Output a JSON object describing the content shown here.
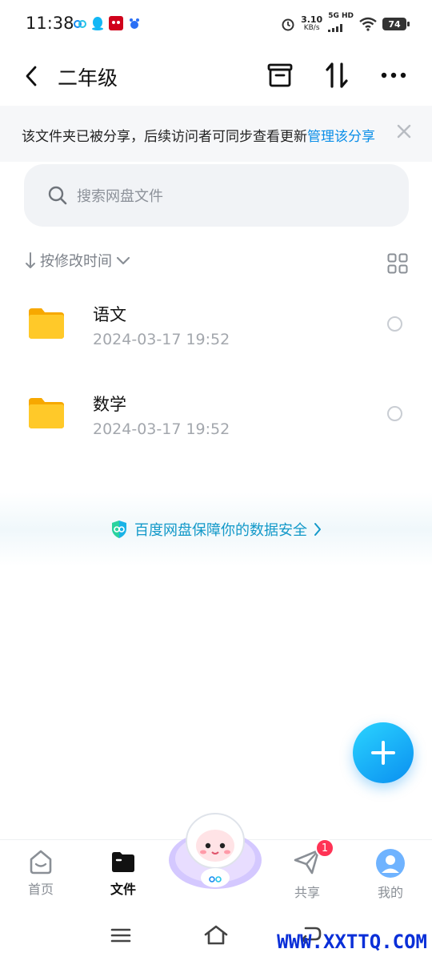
{
  "status": {
    "time": "11:38",
    "speed_value": "3.10",
    "speed_unit": "KB/s",
    "network_top": "5G HD",
    "battery": "74"
  },
  "header": {
    "title": "二年级"
  },
  "share_banner": {
    "text": "该文件夹已被分享，后续访问者可同步查看更新",
    "link": "管理该分享"
  },
  "search": {
    "placeholder": "搜索网盘文件"
  },
  "sort": {
    "label": "按修改时间"
  },
  "files": [
    {
      "name": "语文",
      "date": "2024-03-17  19:52"
    },
    {
      "name": "数学",
      "date": "2024-03-17  19:52"
    }
  ],
  "security": {
    "text": "百度网盘保障你的数据安全"
  },
  "tabs": [
    {
      "label": "首页"
    },
    {
      "label": "文件"
    },
    {
      "label": "共享"
    },
    {
      "label": "我的"
    }
  ],
  "share_badge": "1",
  "watermark": "WWW.XXTTQ.COM",
  "colors": {
    "accent": "#0a8ee8",
    "fab": "#13a8f5",
    "folder": "#ffc21a",
    "badge": "#ff3355"
  }
}
